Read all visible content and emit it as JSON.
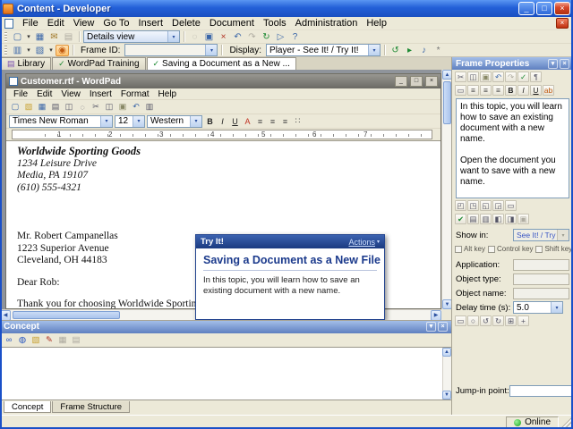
{
  "window": {
    "title": "Content - Developer",
    "minimize_glyph": "_",
    "maximize_glyph": "□",
    "close_glyph": "×"
  },
  "glyphs": {
    "down": "▾",
    "up": "▲",
    "down_arrow": "▼",
    "left": "◀",
    "right": "▶",
    "pin": "▾",
    "close": "×"
  },
  "menu": {
    "items": [
      "File",
      "Edit",
      "View",
      "Go To",
      "Insert",
      "Delete",
      "Document",
      "Tools",
      "Administration",
      "Help"
    ],
    "close_glyph": "×"
  },
  "toolbar1": {
    "details_view": "Details view",
    "icons_a": [
      {
        "n": "new-document-icon",
        "g": "▢",
        "c": "#3A66A8"
      },
      {
        "n": "new-document-dropdown-icon",
        "g": "▾",
        "c": "#333",
        "cls": "dd"
      },
      {
        "n": "save-icon",
        "g": "▦",
        "c": "#3A66A8"
      },
      {
        "n": "send-for-review-icon",
        "g": "✉",
        "c": "#A07828"
      },
      {
        "n": "print-icon",
        "g": "▤",
        "c": "#AEABA0",
        "cls": "dis"
      }
    ],
    "icons_b": [
      {
        "n": "find-icon",
        "g": "◌",
        "c": "#AEABA0",
        "cls": "dis"
      },
      {
        "n": "properties-icon",
        "g": "▣",
        "c": "#3A66A8"
      },
      {
        "n": "delete-icon",
        "g": "×",
        "c": "#B03020"
      },
      {
        "n": "undo-icon",
        "g": "↶",
        "c": "#3A66A8"
      },
      {
        "n": "redo-icon",
        "g": "↷",
        "c": "#AEABA0",
        "cls": "dis"
      },
      {
        "n": "refresh-icon",
        "g": "↻",
        "c": "#1E8A34"
      },
      {
        "n": "preview-icon",
        "g": "▷",
        "c": "#3A66A8"
      },
      {
        "n": "help-icon",
        "g": "?",
        "c": "#3A66A8"
      }
    ]
  },
  "toolbar2": {
    "frame_id_label": "Frame ID:",
    "display_label": "Display:",
    "display_value": "Player - See It! / Try It!",
    "icons_a": [
      {
        "n": "insert-frame-icon",
        "g": "▥",
        "c": "#3A66A8"
      },
      {
        "n": "insert-frame-dropdown-icon",
        "g": "▾",
        "c": "#333",
        "cls": "dd"
      },
      {
        "n": "insert-object-icon",
        "g": "▧",
        "c": "#3A66A8"
      },
      {
        "n": "insert-object-dropdown-icon",
        "g": "▾",
        "c": "#333",
        "cls": "dd"
      },
      {
        "n": "recapture-screen-icon",
        "g": "◉",
        "c": "#C05A10",
        "cls": "act"
      }
    ],
    "icons_b": [
      {
        "n": "refresh-player-icon",
        "g": "↺",
        "c": "#1E8A34"
      },
      {
        "n": "play-frame-icon",
        "g": "▸",
        "c": "#1E8A34"
      },
      {
        "n": "audio-icon",
        "g": "♪",
        "c": "#3A66A8"
      },
      {
        "n": "frame-settings-icon",
        "g": "*",
        "c": "#777"
      }
    ]
  },
  "tabs": {
    "items": [
      {
        "icon": "▤",
        "label": "Library"
      },
      {
        "icon": "✓",
        "label": "WordPad Training"
      },
      {
        "icon": "✓",
        "label": "Saving a Document as a New ..."
      }
    ]
  },
  "wordpad": {
    "title": "Customer.rtf - WordPad",
    "btn_min": "_",
    "btn_max": "□",
    "btn_close": "×",
    "menu": [
      "File",
      "Edit",
      "View",
      "Insert",
      "Format",
      "Help"
    ],
    "toolbar_icons": [
      {
        "n": "new-icon",
        "g": "▢",
        "c": "#3A66A8"
      },
      {
        "n": "open-icon",
        "g": "▧",
        "c": "#C8A030"
      },
      {
        "n": "save-icon",
        "g": "▦",
        "c": "#3A66A8"
      },
      {
        "n": "print-icon",
        "g": "▤",
        "c": "#556"
      },
      {
        "n": "print-preview-icon",
        "g": "◫",
        "c": "#556"
      },
      {
        "n": "find-icon",
        "g": "◌",
        "c": "#556"
      },
      {
        "n": "cut-icon",
        "g": "✂",
        "c": "#556"
      },
      {
        "n": "copy-icon",
        "g": "◫",
        "c": "#556"
      },
      {
        "n": "paste-icon",
        "g": "▣",
        "c": "#886"
      },
      {
        "n": "undo-icon",
        "g": "↶",
        "c": "#3A66A8"
      },
      {
        "n": "datetime-icon",
        "g": "▥",
        "c": "#556"
      }
    ],
    "font_name": "Times New Roman",
    "font_size": "12",
    "script": "Western",
    "format_icons": [
      {
        "n": "bold-icon",
        "g": "B",
        "c": "#222",
        "cls": "b"
      },
      {
        "n": "italic-icon",
        "g": "I",
        "c": "#222",
        "cls": "i"
      },
      {
        "n": "underline-icon",
        "g": "U",
        "c": "#222",
        "cls": "u"
      },
      {
        "n": "font-color-icon",
        "g": "A",
        "c": "#C03020"
      },
      {
        "n": "align-left-icon",
        "g": "≡",
        "c": "#444"
      },
      {
        "n": "align-center-icon",
        "g": "≡",
        "c": "#444"
      },
      {
        "n": "align-right-icon",
        "g": "≡",
        "c": "#444"
      },
      {
        "n": "bullets-icon",
        "g": "∷",
        "c": "#444"
      }
    ],
    "ruler": [
      "1",
      "2",
      "3",
      "4",
      "5",
      "6",
      "7"
    ],
    "doc": {
      "company": "Worldwide Sporting Goods",
      "addr1": "1234 Leisure Drive",
      "addr2": "Media, PA 19107",
      "phone": "(610) 555-4321",
      "rcpt1": "Mr. Robert Campanellas",
      "rcpt2": "1223 Superior Avenue",
      "rcpt3": "Cleveland, OH 44183",
      "salutation": "Dear Rob:",
      "body": "Thank you for choosing Worldwide Sporting Goods"
    }
  },
  "tryit": {
    "title": "Try It!",
    "actions_label": "Actions",
    "heading": "Saving a Document as a New File",
    "body": "In this topic, you will learn how to save an existing document with a new name."
  },
  "frame_properties": {
    "title": "Frame Properties",
    "toolbar_a": [
      {
        "n": "cut-icon",
        "g": "✂",
        "c": "#556"
      },
      {
        "n": "copy-icon",
        "g": "◫",
        "c": "#556"
      },
      {
        "n": "paste-icon",
        "g": "▣",
        "c": "#886"
      },
      {
        "n": "undo-icon",
        "g": "↶",
        "c": "#3A66A8"
      },
      {
        "n": "redo-icon",
        "g": "↷",
        "c": "#AEABA0",
        "cls": "dis"
      },
      {
        "n": "spellcheck-icon",
        "g": "✓",
        "c": "#1E8A34"
      },
      {
        "n": "translate-icon",
        "g": "¶",
        "c": "#556"
      }
    ],
    "toolbar_b": [
      {
        "n": "bubble-template-icon",
        "g": "▭",
        "c": "#556"
      },
      {
        "n": "align-left-icon",
        "g": "≡",
        "c": "#444"
      },
      {
        "n": "align-center-icon",
        "g": "≡",
        "c": "#444"
      },
      {
        "n": "align-right-icon",
        "g": "≡",
        "c": "#444"
      },
      {
        "n": "bold-icon",
        "g": "B",
        "c": "#222",
        "cls": "b"
      },
      {
        "n": "italic-icon",
        "g": "I",
        "c": "#222",
        "cls": "i"
      },
      {
        "n": "underline-icon",
        "g": "U",
        "c": "#222",
        "cls": "u"
      },
      {
        "n": "highlight-icon",
        "g": "ab",
        "c": "#C05A10"
      }
    ],
    "bubble_paragraph_1": "In this topic, you will learn how to save an existing document with a new name.",
    "bubble_paragraph_2": "Open the document you want to save with a new name.",
    "pointer_icons": [
      {
        "n": "bubble-pointer-top-left-icon",
        "g": "◰",
        "c": "#556"
      },
      {
        "n": "bubble-pointer-top-right-icon",
        "g": "◳",
        "c": "#556"
      },
      {
        "n": "bubble-pointer-bottom-left-icon",
        "g": "◱",
        "c": "#556"
      },
      {
        "n": "bubble-pointer-bottom-right-icon",
        "g": "◲",
        "c": "#556"
      },
      {
        "n": "bubble-no-pointer-icon",
        "g": "▭",
        "c": "#556"
      }
    ],
    "display_icons": [
      {
        "n": "show-bubble-icon",
        "g": "✔",
        "c": "#1E8A34"
      },
      {
        "n": "bubble-style-icon",
        "g": "▤",
        "c": "#556"
      },
      {
        "n": "attach-template-icon",
        "g": "▥",
        "c": "#556"
      },
      {
        "n": "image-left-icon",
        "g": "◧",
        "c": "#556"
      },
      {
        "n": "image-right-icon",
        "g": "◨",
        "c": "#556"
      },
      {
        "n": "image-none-icon",
        "g": "▣",
        "c": "#AEABA0",
        "cls": "dis"
      }
    ],
    "show_in_label": "Show in:",
    "show_in_value": "See It! / Try It!, Know It?, Do It!",
    "keys": [
      "Alt key",
      "Control key",
      "Shift key"
    ],
    "application_label": "Application:",
    "object_type_label": "Object type:",
    "object_name_label": "Object name:",
    "delay_label": "Delay time (s):",
    "delay_value": "5.0",
    "action_icons": [
      {
        "n": "area-select-icon",
        "g": "▭",
        "c": "#556"
      },
      {
        "n": "circle-select-icon",
        "g": "○",
        "c": "#556"
      },
      {
        "n": "rotate-left-icon",
        "g": "↺",
        "c": "#556"
      },
      {
        "n": "rotate-right-icon",
        "g": "↻",
        "c": "#556"
      },
      {
        "n": "grid-icon",
        "g": "⊞",
        "c": "#556"
      },
      {
        "n": "crosshair-icon",
        "g": "+",
        "c": "#556"
      }
    ],
    "jump_in_label": "Jump-in point:"
  },
  "concept": {
    "title": "Concept",
    "toolbar_icons": [
      {
        "n": "insert-link-icon",
        "g": "∞",
        "c": "#2A58C0"
      },
      {
        "n": "insert-web-page-icon",
        "g": "◍",
        "c": "#2A58C0"
      },
      {
        "n": "insert-image-icon",
        "g": "▧",
        "c": "#C8A030"
      },
      {
        "n": "edit-text-icon",
        "g": "✎",
        "c": "#B03020"
      },
      {
        "n": "insert-table-icon",
        "g": "▦",
        "c": "#AEABA0",
        "cls": "dis"
      },
      {
        "n": "insert-chart-icon",
        "g": "▤",
        "c": "#AEABA0",
        "cls": "dis"
      }
    ]
  },
  "bottom_tabs": [
    "Concept",
    "Frame Structure"
  ],
  "status": {
    "online_label": "Online"
  },
  "colors": {
    "titlebar_blue": "#2360D8",
    "panel_header_blue": "#5F80C0",
    "heading_blue": "#1B3A8C",
    "online_green": "#16A016",
    "active_toggle_orange": "#E2953C"
  }
}
